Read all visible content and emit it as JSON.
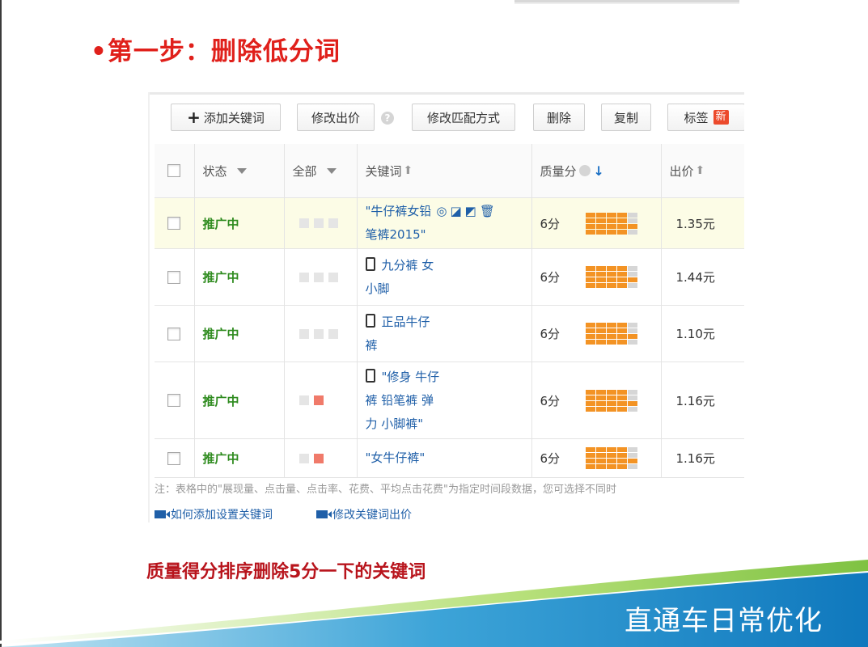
{
  "slide": {
    "title": "•第一步：删除低分词",
    "caption": "质量得分排序删除5分一下的关键词",
    "footer_title": "直通车日常优化"
  },
  "toolbar": {
    "add_keyword": "添加关键词",
    "modify_bid": "修改出价",
    "modify_match": "修改匹配方式",
    "delete": "删除",
    "copy": "复制",
    "tag": "标签",
    "new_badge": "新"
  },
  "table": {
    "headers": {
      "status": "状态",
      "all": "全部",
      "keyword": "关键词",
      "quality": "质量分",
      "bid": "出价"
    },
    "rows": [
      {
        "status": "推广中",
        "keyword_lines": [
          "\"牛仔裤女铅",
          "笔裤2015\""
        ],
        "quality": "6分",
        "price": "1.35元",
        "squares": [
          "off",
          "off",
          "off"
        ],
        "phone": false,
        "highlight": true
      },
      {
        "status": "推广中",
        "keyword_lines": [
          "九分裤 女",
          "小脚"
        ],
        "quality": "6分",
        "price": "1.44元",
        "squares": [
          "off",
          "off",
          "off"
        ],
        "phone": true,
        "highlight": false
      },
      {
        "status": "推广中",
        "keyword_lines": [
          "正品牛仔",
          "裤"
        ],
        "quality": "6分",
        "price": "1.10元",
        "squares": [
          "off",
          "off",
          "off"
        ],
        "phone": true,
        "highlight": false
      },
      {
        "status": "推广中",
        "keyword_lines": [
          "\"修身 牛仔",
          "裤 铅笔裤 弹",
          "力 小脚裤\""
        ],
        "quality": "6分",
        "price": "1.16元",
        "squares": [
          "off",
          "red"
        ],
        "phone": true,
        "highlight": false
      },
      {
        "status": "推广中",
        "keyword_lines": [
          "\"女牛仔裤\""
        ],
        "quality": "6分",
        "price": "1.16元",
        "squares": [
          "off",
          "red"
        ],
        "phone": false,
        "highlight": false
      }
    ]
  },
  "note": "注：表格中的\"展现量、点击量、点击率、花费、平均点击花费\"为指定时间段数据，您可选择不同时",
  "links": {
    "how_add": "如何添加设置关键词",
    "modify_bid": "修改关键词出价"
  },
  "colors": {
    "title_red": "#e0201b",
    "caption_red": "#b8141c",
    "status_green": "#2e8b1e",
    "link_blue": "#1f5fa8",
    "quality_orange": "#f39324",
    "footer_blue": "#1b86c7"
  }
}
